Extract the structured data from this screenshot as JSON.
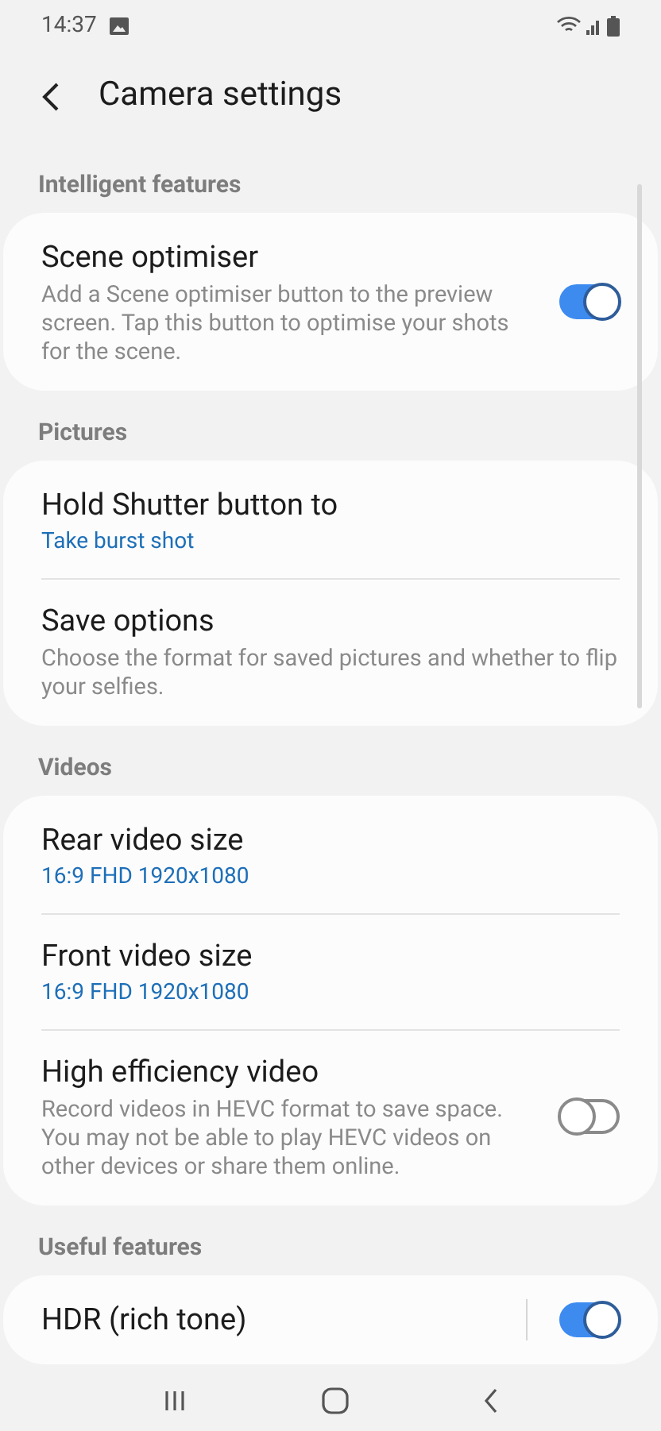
{
  "status_bar": {
    "time": "14:37"
  },
  "header": {
    "title": "Camera settings"
  },
  "sections": [
    {
      "heading": "Intelligent features",
      "items": [
        {
          "kind": "switch",
          "title": "Scene optimiser",
          "summary": "Add a Scene optimiser button to the preview screen. Tap this button to optimise your shots for the scene.",
          "on": true
        }
      ]
    },
    {
      "heading": "Pictures",
      "items": [
        {
          "kind": "link",
          "title": "Hold Shutter button to",
          "value": "Take burst shot"
        },
        {
          "kind": "link",
          "title": "Save options",
          "summary": "Choose the format for saved pictures and whether to flip your selfies."
        }
      ]
    },
    {
      "heading": "Videos",
      "items": [
        {
          "kind": "link",
          "title": "Rear video size",
          "value": "16:9 FHD 1920x1080"
        },
        {
          "kind": "link",
          "title": "Front video size",
          "value": "16:9 FHD 1920x1080"
        },
        {
          "kind": "switch",
          "title": "High efficiency video",
          "summary": "Record videos in HEVC format to save space. You may not be able to play HEVC videos on other devices or share them online.",
          "on": false
        }
      ]
    },
    {
      "heading": "Useful features",
      "items": [
        {
          "kind": "switch",
          "title": "HDR (rich tone)",
          "on": true,
          "split": true
        }
      ]
    }
  ]
}
